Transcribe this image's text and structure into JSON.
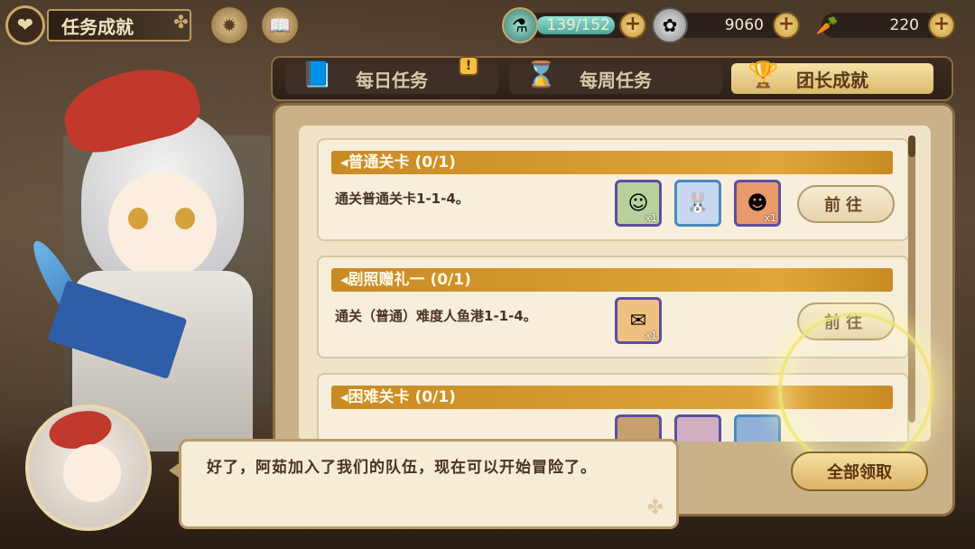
{
  "header": {
    "title": "任务成就",
    "back_icon": "heart-back-icon",
    "clover_icon": "clover-icon",
    "compass_icon": "compass-icon",
    "book_icon": "book-icon"
  },
  "resources": {
    "stamina": {
      "icon": "potion-icon",
      "value": "139/152",
      "fill": 0.91
    },
    "coin": {
      "icon": "coin-icon",
      "value": "9060"
    },
    "carrot": {
      "icon": "carrot-icon",
      "value": "220"
    }
  },
  "tabs": [
    {
      "label": "每日任务",
      "icon": "quill-book-icon",
      "badge": "!",
      "active": false
    },
    {
      "label": "每周任务",
      "icon": "hourglass-icon",
      "active": false
    },
    {
      "label": "团长成就",
      "icon": "trophy-icon",
      "active": true
    }
  ],
  "tasks": [
    {
      "title": "◂普通关卡 (0/1)",
      "desc": "通关普通关卡1-1-4。",
      "rewards": [
        {
          "icon": "character-reward-icon",
          "qty": "x1"
        },
        {
          "icon": "bunny-reward-icon",
          "qty": ""
        },
        {
          "icon": "redhead-reward-icon",
          "qty": "x1"
        }
      ],
      "button": "前往"
    },
    {
      "title": "◂剧照赠礼一 (0/1)",
      "desc": "通关（普通）难度人鱼港1-1-4。",
      "rewards": [
        {
          "icon": "photo-reward-icon",
          "qty": "x1"
        }
      ],
      "button": "前往"
    },
    {
      "title": "◂困难关卡 (0/1)",
      "desc": "",
      "rewards": [],
      "button": ""
    }
  ],
  "claim_all": "全部领取",
  "dialog": {
    "text": "好了，阿茹加入了我们的队伍，现在可以开始冒险了。",
    "deco_icon": "clover-icon"
  },
  "colors": {
    "task_header": "#e0a63a",
    "active_tab": "#f6e3a6",
    "panel": "#c9b28a"
  }
}
